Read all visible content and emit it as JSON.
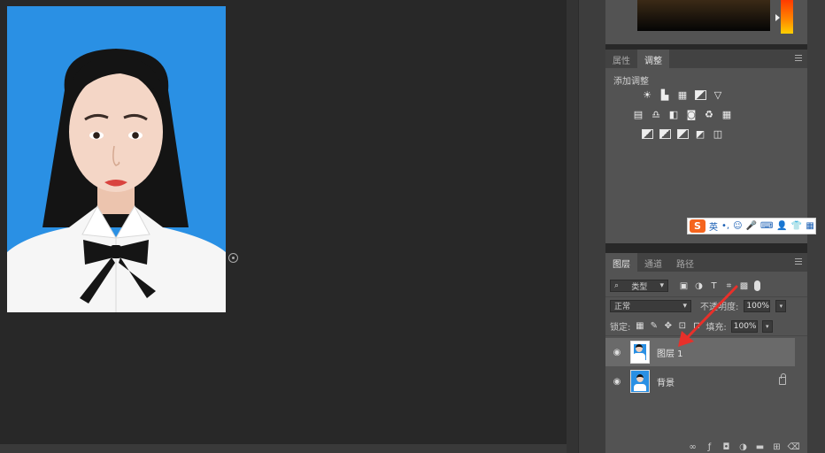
{
  "adjustments_panel": {
    "tabs": [
      "属性",
      "调整"
    ],
    "active_tab": "调整",
    "title": "添加调整"
  },
  "ime_toolbar": {
    "logo": "S",
    "mode": "英",
    "items": [
      "•,",
      "☺",
      "🎤",
      "⌨",
      "👤",
      "👕",
      "▦"
    ]
  },
  "layers_panel": {
    "tabs": [
      "图层",
      "通道",
      "路径"
    ],
    "active_tab": "图层",
    "filter_kind": "类型",
    "blend_mode": "正常",
    "opacity_label": "不透明度:",
    "opacity_value": "100%",
    "lock_label": "锁定:",
    "fill_label": "填充:",
    "fill_value": "100%",
    "layers": [
      {
        "name": "图层 1",
        "selected": true
      },
      {
        "name": "背景",
        "selected": false,
        "locked": true
      }
    ],
    "bottom_icons": [
      "link-icon",
      "fx-icon",
      "mask-icon",
      "adjustment-icon",
      "folder-icon",
      "new-layer-icon",
      "trash-icon"
    ]
  },
  "colors": {
    "photo_background": "#2a90e4",
    "arrow": "#e8302a",
    "panel": "#535353",
    "workspace": "#282828"
  }
}
